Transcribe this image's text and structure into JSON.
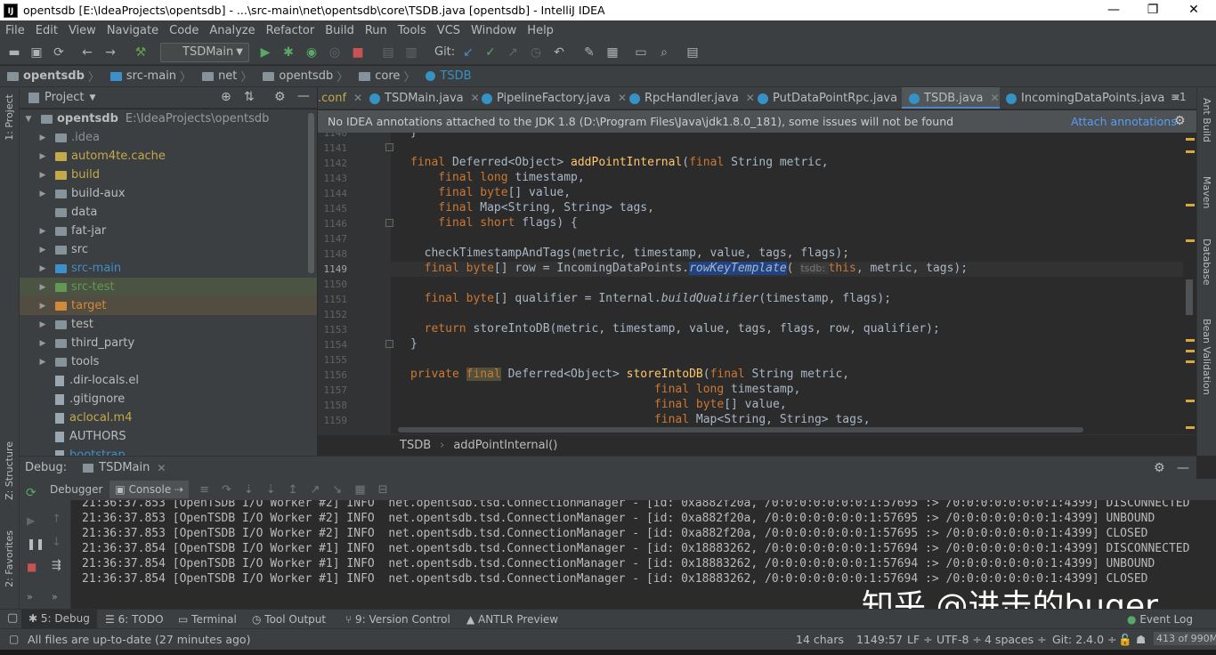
{
  "window": {
    "title": "opentsdb [E:\\IdeaProjects\\opentsdb] - ...\\src-main\\net\\opentsdb\\core\\TSDB.java [opentsdb] - IntelliJ IDEA",
    "app_icon": "IJ",
    "minimize": "—",
    "restore": "❐",
    "close": "✕"
  },
  "menu": [
    "File",
    "Edit",
    "View",
    "Navigate",
    "Code",
    "Analyze",
    "Refactor",
    "Build",
    "Run",
    "Tools",
    "VCS",
    "Window",
    "Help"
  ],
  "toolbar": {
    "run_config": "TSDMain",
    "git_label": "Git:"
  },
  "breadcrumb": [
    "opentsdb",
    "src-main",
    "net",
    "opentsdb",
    "core",
    "TSDB"
  ],
  "project": {
    "header": "Project",
    "root_name": "opentsdb",
    "root_path": "E:\\IdeaProjects\\opentsdb",
    "items": [
      {
        "label": ".idea",
        "color": "#87939a",
        "arrow": "▶",
        "kind": "folder"
      },
      {
        "label": "autom4te.cache",
        "color": "#c3a94a",
        "arrow": "▶",
        "kind": "folder"
      },
      {
        "label": "build",
        "color": "#c3a94a",
        "arrow": "▶",
        "kind": "folder"
      },
      {
        "label": "build-aux",
        "color": "#bbbbbb",
        "arrow": "▶",
        "kind": "folder"
      },
      {
        "label": "data",
        "color": "#bbbbbb",
        "arrow": "",
        "kind": "folder"
      },
      {
        "label": "fat-jar",
        "color": "#bbbbbb",
        "arrow": "▶",
        "kind": "folder"
      },
      {
        "label": "src",
        "color": "#bbbbbb",
        "arrow": "▶",
        "kind": "folder"
      },
      {
        "label": "src-main",
        "color": "#3d8fc9",
        "arrow": "▶",
        "kind": "folder"
      },
      {
        "label": "src-test",
        "color": "#629755",
        "arrow": "▶",
        "kind": "folder"
      },
      {
        "label": "target",
        "color": "#d08a3c",
        "arrow": "▶",
        "kind": "folder"
      },
      {
        "label": "test",
        "color": "#bbbbbb",
        "arrow": "▶",
        "kind": "folder"
      },
      {
        "label": "third_party",
        "color": "#bbbbbb",
        "arrow": "▶",
        "kind": "folder"
      },
      {
        "label": "tools",
        "color": "#bbbbbb",
        "arrow": "▶",
        "kind": "folder"
      },
      {
        "label": ".dir-locals.el",
        "color": "#bbbbbb",
        "arrow": "",
        "kind": "file"
      },
      {
        "label": ".gitignore",
        "color": "#bbbbbb",
        "arrow": "",
        "kind": "file"
      },
      {
        "label": "aclocal.m4",
        "color": "#c3a94a",
        "arrow": "",
        "kind": "file"
      },
      {
        "label": "AUTHORS",
        "color": "#bbbbbb",
        "arrow": "",
        "kind": "file"
      },
      {
        "label": "bootstrap",
        "color": "#3d8fc9",
        "arrow": "",
        "kind": "file"
      }
    ]
  },
  "editor_tabs": [
    ".conf",
    "TSDMain.java",
    "PipelineFactory.java",
    "RpcHandler.java",
    "PutDataPointRpc.java",
    "TSDB.java",
    "IncomingDataPoints.java"
  ],
  "editor_tabs_overflow": "≡1",
  "banner": {
    "message": "No IDEA annotations attached to the JDK 1.8 (D:\\Program Files\\Java\\jdk1.8.0_181), some issues will not be found",
    "action": "Attach annotations"
  },
  "editor": {
    "line_numbers": [
      "1140",
      "1141",
      "1142",
      "1143",
      "1144",
      "1145",
      "1146",
      "1147",
      "1148",
      "1149",
      "1150",
      "1151",
      "1152",
      "1153",
      "1154",
      "1155",
      "1156",
      "1157",
      "1158",
      "1159"
    ],
    "current_line": "1149",
    "lines": [
      [
        {
          "t": "}"
        }
      ],
      [],
      [
        {
          "t": "final ",
          "c": "kw"
        },
        {
          "t": "Deferred<Object> "
        },
        {
          "t": "addPointInternal",
          "c": "fn"
        },
        {
          "t": "("
        },
        {
          "t": "final ",
          "c": "kw"
        },
        {
          "t": "String metric,"
        }
      ],
      [
        {
          "t": "    final long ",
          "c": "kw"
        },
        {
          "t": "timestamp,"
        }
      ],
      [
        {
          "t": "    final byte",
          "c": "kw"
        },
        {
          "t": "[] value,"
        }
      ],
      [
        {
          "t": "    final ",
          "c": "kw"
        },
        {
          "t": "Map<String, String> tags,"
        }
      ],
      [
        {
          "t": "    final short ",
          "c": "kw"
        },
        {
          "t": "flags) {"
        }
      ],
      [],
      [
        {
          "t": "  checkTimestampAndTags(metric, timestamp, value, tags, flags);"
        }
      ],
      [
        {
          "t": "  final byte",
          "c": "kw"
        },
        {
          "t": "[] row = IncomingDataPoints."
        },
        {
          "t": "rowKeyTemplate",
          "c": "it sel"
        },
        {
          "t": "( "
        },
        {
          "t": "tsdb: ",
          "c": "hint"
        },
        {
          "t": "this",
          "c": "kw"
        },
        {
          "t": ", metric, tags);"
        }
      ],
      [],
      [
        {
          "t": "  final byte",
          "c": "kw"
        },
        {
          "t": "[] qualifier = Internal."
        },
        {
          "t": "buildQualifier",
          "c": "it"
        },
        {
          "t": "(timestamp, flags);"
        }
      ],
      [],
      [
        {
          "t": "  return ",
          "c": "kw"
        },
        {
          "t": "storeIntoDB(metric, timestamp, value, tags, flags, row, qualifier);"
        }
      ],
      [
        {
          "t": "}"
        }
      ],
      [],
      [
        {
          "t": "private ",
          "c": "kw"
        },
        {
          "t": "final",
          "c": "kw hl"
        },
        {
          "t": " Deferred<Object> "
        },
        {
          "t": "storeIntoDB",
          "c": "fn"
        },
        {
          "t": "("
        },
        {
          "t": "final ",
          "c": "kw"
        },
        {
          "t": "String metric,"
        }
      ],
      [
        {
          "t": "                                   final long ",
          "c": "kw"
        },
        {
          "t": "timestamp,"
        }
      ],
      [
        {
          "t": "                                   final byte",
          "c": "kw"
        },
        {
          "t": "[] value,"
        }
      ],
      [
        {
          "t": "                                   final ",
          "c": "kw"
        },
        {
          "t": "Map<String, String> tags,"
        }
      ]
    ]
  },
  "code_breadcrumb": [
    "TSDB",
    "addPointInternal()"
  ],
  "debug": {
    "label": "Debug:",
    "session": "TSDMain",
    "tabs": [
      "Debugger",
      "Console"
    ],
    "console_lines": [
      "21:36:37.853 [OpenTSDB I/O Worker #2] INFO  net.opentsdb.tsd.ConnectionManager - [id: 0xa882f20a, /0:0:0:0:0:0:0:1:57695 :> /0:0:0:0:0:0:0:1:4399] DISCONNECTED",
      "21:36:37.853 [OpenTSDB I/O Worker #2] INFO  net.opentsdb.tsd.ConnectionManager - [id: 0xa882f20a, /0:0:0:0:0:0:0:1:57695 :> /0:0:0:0:0:0:0:1:4399] UNBOUND",
      "21:36:37.853 [OpenTSDB I/O Worker #2] INFO  net.opentsdb.tsd.ConnectionManager - [id: 0xa882f20a, /0:0:0:0:0:0:0:1:57695 :> /0:0:0:0:0:0:0:1:4399] CLOSED",
      "21:36:37.854 [OpenTSDB I/O Worker #1] INFO  net.opentsdb.tsd.ConnectionManager - [id: 0x18883262, /0:0:0:0:0:0:0:1:57694 :> /0:0:0:0:0:0:0:1:4399] DISCONNECTED",
      "21:36:37.854 [OpenTSDB I/O Worker #1] INFO  net.opentsdb.tsd.ConnectionManager - [id: 0x18883262, /0:0:0:0:0:0:0:1:57694 :> /0:0:0:0:0:0:0:1:4399] UNBOUND",
      "21:36:37.854 [OpenTSDB I/O Worker #1] INFO  net.opentsdb.tsd.ConnectionManager - [id: 0x18883262, /0:0:0:0:0:0:0:1:57694 :> /0:0:0:0:0:0:0:1:4399] CLOSED"
    ]
  },
  "left_strip": {
    "project": "1: Project",
    "structure": "Z: Structure",
    "favorites": "2: Favorites"
  },
  "right_strip": [
    "Ant Build",
    "Maven",
    "Database",
    "Bean Validation"
  ],
  "bottom_tabs": [
    "5: Debug",
    "6: TODO",
    "Terminal",
    "Tool Output",
    "9: Version Control",
    "ANTLR Preview"
  ],
  "event_log": "Event Log",
  "status": {
    "message": "All files are up-to-date (27 minutes ago)",
    "chars": "14 chars",
    "position": "1149:57",
    "line_sep": "LF ÷",
    "encoding": "UTF-8 ÷",
    "indent": "4 spaces ÷",
    "git": "Git: 2.4.0 ÷",
    "memory": "413 of 990M"
  },
  "watermark": "知乎 @进击的buger",
  "colors": {
    "accent": "#4a88c7",
    "keyword": "#cc7832",
    "method": "#ffc66d",
    "text": "#a9b7c6"
  }
}
